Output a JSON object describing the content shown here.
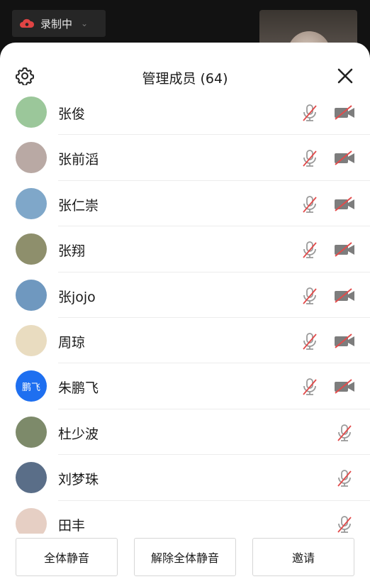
{
  "topbar": {
    "recording_label": "录制中",
    "chevron": "⌄"
  },
  "panel": {
    "title": "管理成员 (64)"
  },
  "icons": {
    "settings": "gear-icon",
    "close": "close-icon",
    "mic": "mic-muted-icon",
    "camera": "camera-off-icon"
  },
  "members": [
    {
      "name": "张俊",
      "avatar_color": "#9bc79a",
      "avatar_text": "",
      "camera": true
    },
    {
      "name": "张前滔",
      "avatar_color": "#b9a9a4",
      "avatar_text": "",
      "camera": true
    },
    {
      "name": "张仁崇",
      "avatar_color": "#7fa7c9",
      "avatar_text": "",
      "camera": true
    },
    {
      "name": "张翔",
      "avatar_color": "#8e8f6c",
      "avatar_text": "",
      "camera": true
    },
    {
      "name": "张jojo",
      "avatar_color": "#6f98bf",
      "avatar_text": "",
      "camera": true
    },
    {
      "name": "周琼",
      "avatar_color": "#e9dcc0",
      "avatar_text": "",
      "camera": true
    },
    {
      "name": "朱鹏飞",
      "avatar_color": "#1e6ff0",
      "avatar_text": "鹏飞",
      "camera": true
    },
    {
      "name": "杜少波",
      "avatar_color": "#7d8a6a",
      "avatar_text": "",
      "camera": false
    },
    {
      "name": "刘梦珠",
      "avatar_color": "#5a6e88",
      "avatar_text": "",
      "camera": false
    },
    {
      "name": "田丰",
      "avatar_color": "#e6cfc4",
      "avatar_text": "",
      "camera": false
    }
  ],
  "footer": {
    "mute_all": "全体静音",
    "unmute_all": "解除全体静音",
    "invite": "邀请"
  }
}
